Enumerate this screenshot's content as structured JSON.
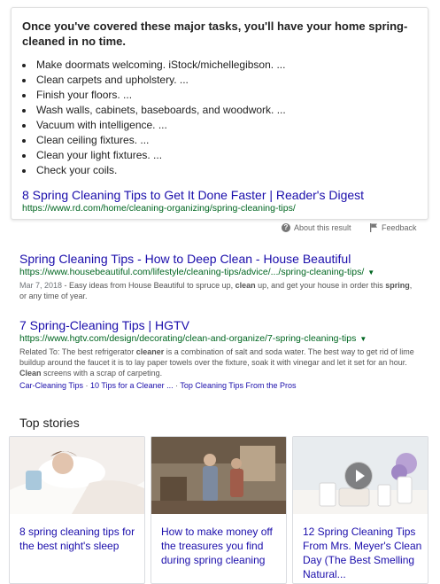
{
  "featured_snippet": {
    "heading": "Once you've covered these major tasks, you'll have your home spring-cleaned in no time.",
    "items": [
      "Make doormats welcoming. iStock/michellegibson. ...",
      "Clean carpets and upholstery. ...",
      "Finish your floors. ...",
      "Wash walls, cabinets, baseboards, and woodwork. ...",
      "Vacuum with intelligence. ...",
      "Clean ceiling fixtures. ...",
      "Clean your light fixtures. ...",
      "Check your coils."
    ],
    "link_title": "8 Spring Cleaning Tips to Get It Done Faster | Reader's Digest",
    "link_url": "https://www.rd.com/home/cleaning-organizing/spring-cleaning-tips/"
  },
  "meta": {
    "about_label": "About this result",
    "feedback_label": "Feedback"
  },
  "results": [
    {
      "title": "Spring Cleaning Tips - How to Deep Clean - House Beautiful",
      "url": "https://www.housebeautiful.com/lifestyle/cleaning-tips/advice/.../spring-cleaning-tips/",
      "date": "Mar 7, 2018",
      "desc_parts": [
        " - Easy ideas from House Beautiful to spruce up, ",
        "clean",
        " up, and get your house in order this ",
        "spring",
        ", or any time of year."
      ]
    },
    {
      "title": "7 Spring-Cleaning Tips | HGTV",
      "url": "https://www.hgtv.com/design/decorating/clean-and-organize/7-spring-cleaning-tips",
      "desc_parts": [
        "Related To: The best refrigerator ",
        "cleaner",
        " is a combination of salt and soda water. The best way to get rid of lime buildup around the faucet it is to lay paper towels over the fixture, soak it with vinegar and let it set for an hour. ",
        "Clean",
        " screens with a scrap of carpeting."
      ],
      "sitelinks": [
        "Car-Cleaning Tips",
        "10 Tips for a Cleaner ...",
        "Top Cleaning Tips From the Pros"
      ],
      "sitelink_sep": " · "
    }
  ],
  "top_stories": {
    "title": "Top stories",
    "stories": [
      {
        "title": "8 spring cleaning tips for the best night's sleep"
      },
      {
        "title": "How to make money off the treasures you find during spring cleaning"
      },
      {
        "title": "12 Spring Cleaning Tips From Mrs. Meyer's Clean Day (The Best Smelling Natural..."
      }
    ]
  },
  "colors": {
    "link": "#1a0dab",
    "url_green": "#006621",
    "snippet_text": "#545454"
  },
  "icons": {
    "about": "help-circle-icon",
    "feedback": "flag-icon",
    "dropdown": "caret-down-icon",
    "video": "play-icon"
  }
}
